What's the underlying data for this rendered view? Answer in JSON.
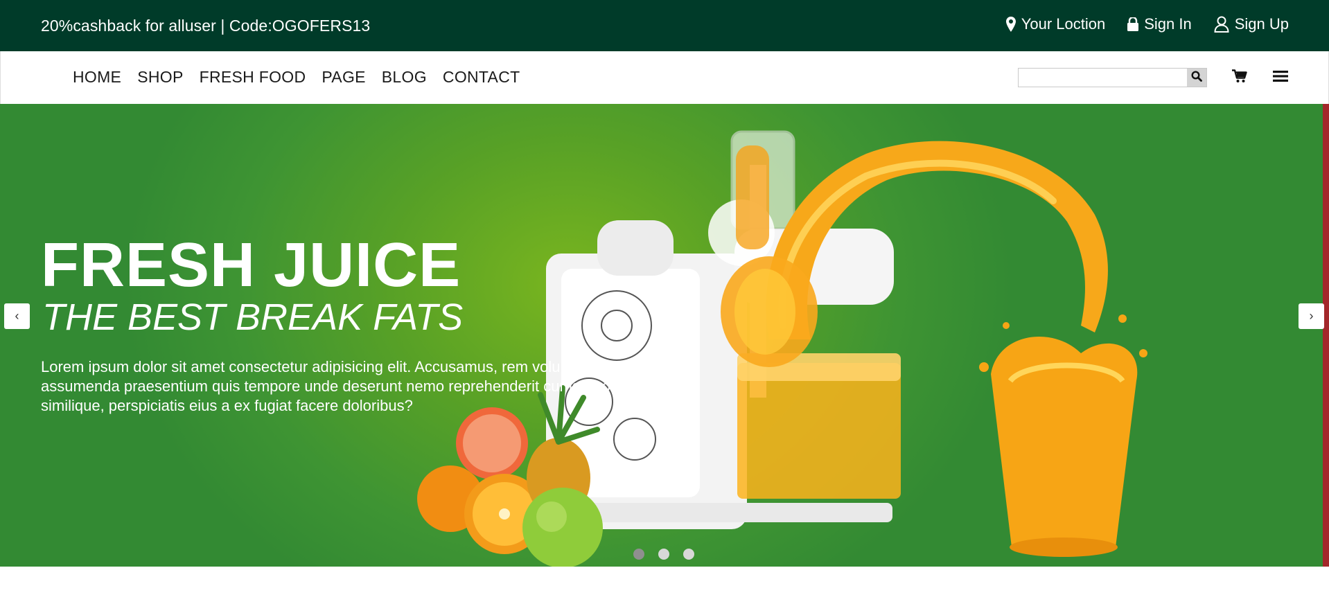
{
  "topbar": {
    "promo": "20%cashback for alluser | Code:OGOFERS13",
    "location_label": "Your Loction",
    "signin_label": "Sign In",
    "signup_label": "Sign Up"
  },
  "nav": {
    "items": [
      "HOME",
      "SHOP",
      "FRESH FOOD",
      "PAGE",
      "BLOG",
      "CONTACT"
    ]
  },
  "search": {
    "value": "",
    "placeholder": ""
  },
  "hero": {
    "title": "FRESH JUICE",
    "subtitle": "THE BEST BREAK FATS",
    "text": "Lorem ipsum dolor sit amet consectetur adipisicing elit. Accusamus, rem voluptas fugit, assumenda praesentium quis tempore unde deserunt nemo reprehenderit cumque officia similique, perspiciatis eius a ex fugiat facere doloribus?",
    "prev_label": "‹",
    "next_label": "›",
    "slides": 3,
    "active_slide": 1
  },
  "colors": {
    "topbar_bg": "#003b29",
    "hero_green": "#3e9433",
    "edge_red": "#a3282b"
  },
  "icons": [
    "map-pin-icon",
    "lock-icon",
    "user-icon",
    "search-icon",
    "cart-icon",
    "hamburger-icon",
    "orange-juice-illustration"
  ]
}
